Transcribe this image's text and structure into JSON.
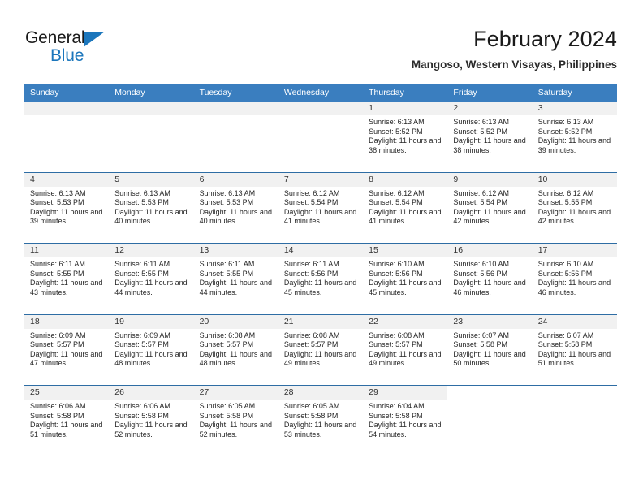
{
  "brand": {
    "name_top": "General",
    "name_bottom": "Blue",
    "accent_color": "#1B76BC",
    "triangle_icon": "triangle-icon"
  },
  "header": {
    "title": "February 2024",
    "subtitle": "Mangoso, Western Visayas, Philippines"
  },
  "calendar": {
    "header_bg": "#3A7EBF",
    "divider_color": "#2E6DA4",
    "daynum_band_bg": "#f1f1f1",
    "weekdays": [
      "Sunday",
      "Monday",
      "Tuesday",
      "Wednesday",
      "Thursday",
      "Friday",
      "Saturday"
    ],
    "weeks": [
      [
        {
          "day": "",
          "lines": []
        },
        {
          "day": "",
          "lines": []
        },
        {
          "day": "",
          "lines": []
        },
        {
          "day": "",
          "lines": []
        },
        {
          "day": "1",
          "lines": [
            "Sunrise: 6:13 AM",
            "Sunset: 5:52 PM",
            "Daylight: 11 hours and 38 minutes."
          ]
        },
        {
          "day": "2",
          "lines": [
            "Sunrise: 6:13 AM",
            "Sunset: 5:52 PM",
            "Daylight: 11 hours and 38 minutes."
          ]
        },
        {
          "day": "3",
          "lines": [
            "Sunrise: 6:13 AM",
            "Sunset: 5:52 PM",
            "Daylight: 11 hours and 39 minutes."
          ]
        }
      ],
      [
        {
          "day": "4",
          "lines": [
            "Sunrise: 6:13 AM",
            "Sunset: 5:53 PM",
            "Daylight: 11 hours and 39 minutes."
          ]
        },
        {
          "day": "5",
          "lines": [
            "Sunrise: 6:13 AM",
            "Sunset: 5:53 PM",
            "Daylight: 11 hours and 40 minutes."
          ]
        },
        {
          "day": "6",
          "lines": [
            "Sunrise: 6:13 AM",
            "Sunset: 5:53 PM",
            "Daylight: 11 hours and 40 minutes."
          ]
        },
        {
          "day": "7",
          "lines": [
            "Sunrise: 6:12 AM",
            "Sunset: 5:54 PM",
            "Daylight: 11 hours and 41 minutes."
          ]
        },
        {
          "day": "8",
          "lines": [
            "Sunrise: 6:12 AM",
            "Sunset: 5:54 PM",
            "Daylight: 11 hours and 41 minutes."
          ]
        },
        {
          "day": "9",
          "lines": [
            "Sunrise: 6:12 AM",
            "Sunset: 5:54 PM",
            "Daylight: 11 hours and 42 minutes."
          ]
        },
        {
          "day": "10",
          "lines": [
            "Sunrise: 6:12 AM",
            "Sunset: 5:55 PM",
            "Daylight: 11 hours and 42 minutes."
          ]
        }
      ],
      [
        {
          "day": "11",
          "lines": [
            "Sunrise: 6:11 AM",
            "Sunset: 5:55 PM",
            "Daylight: 11 hours and 43 minutes."
          ]
        },
        {
          "day": "12",
          "lines": [
            "Sunrise: 6:11 AM",
            "Sunset: 5:55 PM",
            "Daylight: 11 hours and 44 minutes."
          ]
        },
        {
          "day": "13",
          "lines": [
            "Sunrise: 6:11 AM",
            "Sunset: 5:55 PM",
            "Daylight: 11 hours and 44 minutes."
          ]
        },
        {
          "day": "14",
          "lines": [
            "Sunrise: 6:11 AM",
            "Sunset: 5:56 PM",
            "Daylight: 11 hours and 45 minutes."
          ]
        },
        {
          "day": "15",
          "lines": [
            "Sunrise: 6:10 AM",
            "Sunset: 5:56 PM",
            "Daylight: 11 hours and 45 minutes."
          ]
        },
        {
          "day": "16",
          "lines": [
            "Sunrise: 6:10 AM",
            "Sunset: 5:56 PM",
            "Daylight: 11 hours and 46 minutes."
          ]
        },
        {
          "day": "17",
          "lines": [
            "Sunrise: 6:10 AM",
            "Sunset: 5:56 PM",
            "Daylight: 11 hours and 46 minutes."
          ]
        }
      ],
      [
        {
          "day": "18",
          "lines": [
            "Sunrise: 6:09 AM",
            "Sunset: 5:57 PM",
            "Daylight: 11 hours and 47 minutes."
          ]
        },
        {
          "day": "19",
          "lines": [
            "Sunrise: 6:09 AM",
            "Sunset: 5:57 PM",
            "Daylight: 11 hours and 48 minutes."
          ]
        },
        {
          "day": "20",
          "lines": [
            "Sunrise: 6:08 AM",
            "Sunset: 5:57 PM",
            "Daylight: 11 hours and 48 minutes."
          ]
        },
        {
          "day": "21",
          "lines": [
            "Sunrise: 6:08 AM",
            "Sunset: 5:57 PM",
            "Daylight: 11 hours and 49 minutes."
          ]
        },
        {
          "day": "22",
          "lines": [
            "Sunrise: 6:08 AM",
            "Sunset: 5:57 PM",
            "Daylight: 11 hours and 49 minutes."
          ]
        },
        {
          "day": "23",
          "lines": [
            "Sunrise: 6:07 AM",
            "Sunset: 5:58 PM",
            "Daylight: 11 hours and 50 minutes."
          ]
        },
        {
          "day": "24",
          "lines": [
            "Sunrise: 6:07 AM",
            "Sunset: 5:58 PM",
            "Daylight: 11 hours and 51 minutes."
          ]
        }
      ],
      [
        {
          "day": "25",
          "lines": [
            "Sunrise: 6:06 AM",
            "Sunset: 5:58 PM",
            "Daylight: 11 hours and 51 minutes."
          ]
        },
        {
          "day": "26",
          "lines": [
            "Sunrise: 6:06 AM",
            "Sunset: 5:58 PM",
            "Daylight: 11 hours and 52 minutes."
          ]
        },
        {
          "day": "27",
          "lines": [
            "Sunrise: 6:05 AM",
            "Sunset: 5:58 PM",
            "Daylight: 11 hours and 52 minutes."
          ]
        },
        {
          "day": "28",
          "lines": [
            "Sunrise: 6:05 AM",
            "Sunset: 5:58 PM",
            "Daylight: 11 hours and 53 minutes."
          ]
        },
        {
          "day": "29",
          "lines": [
            "Sunrise: 6:04 AM",
            "Sunset: 5:58 PM",
            "Daylight: 11 hours and 54 minutes."
          ]
        },
        {
          "day": "",
          "lines": [],
          "blank": true
        },
        {
          "day": "",
          "lines": [],
          "blank": true
        }
      ]
    ]
  }
}
